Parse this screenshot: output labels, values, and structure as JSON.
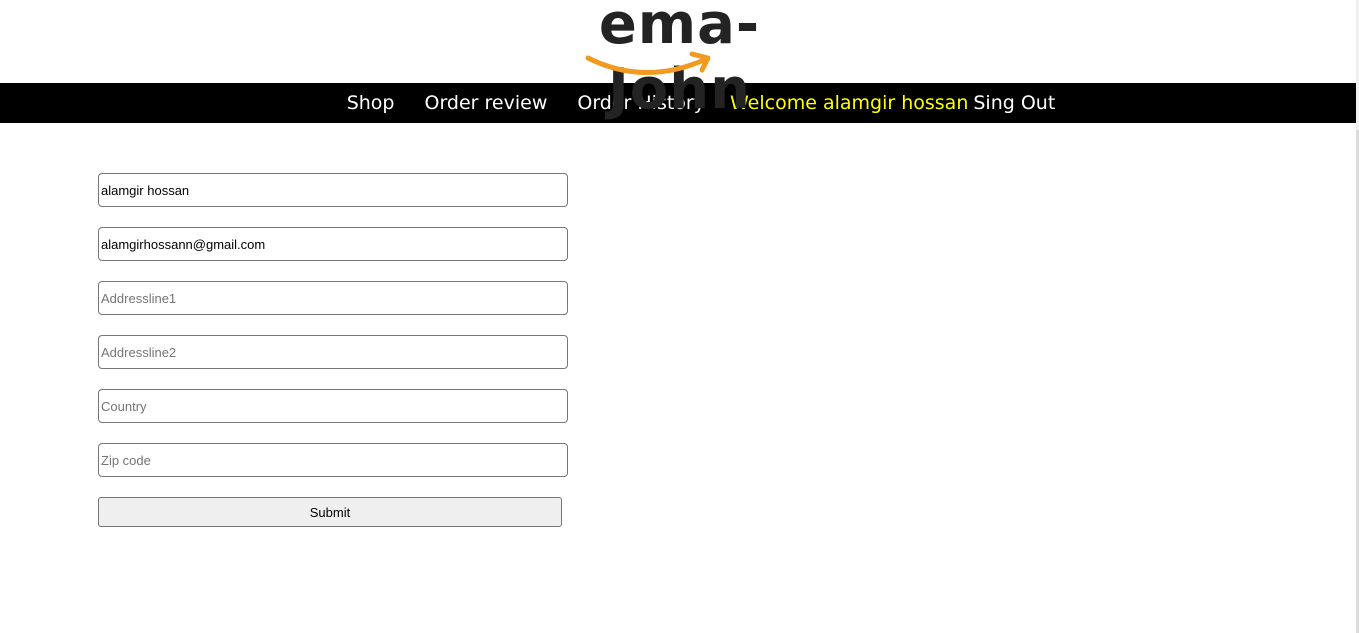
{
  "logo": {
    "text": "ema-John",
    "smile_color": "#f29a1f"
  },
  "nav": {
    "shop": "Shop",
    "order_review": "Order review",
    "order_history": "Order History",
    "welcome": "Welcome alamgir hossan",
    "sign_out": "Sing Out"
  },
  "form": {
    "name": {
      "value": "alamgir hossan",
      "placeholder": ""
    },
    "email": {
      "value": "alamgirhossann@gmail.com",
      "placeholder": ""
    },
    "address1": {
      "value": "",
      "placeholder": "Addressline1"
    },
    "address2": {
      "value": "",
      "placeholder": "Addressline2"
    },
    "country": {
      "value": "",
      "placeholder": "Country"
    },
    "zip": {
      "value": "",
      "placeholder": "Zip code"
    },
    "submit_label": "Submit"
  },
  "colors": {
    "navbar_bg": "#000000",
    "welcome_text": "#ffff00",
    "logo_text": "#232323"
  }
}
